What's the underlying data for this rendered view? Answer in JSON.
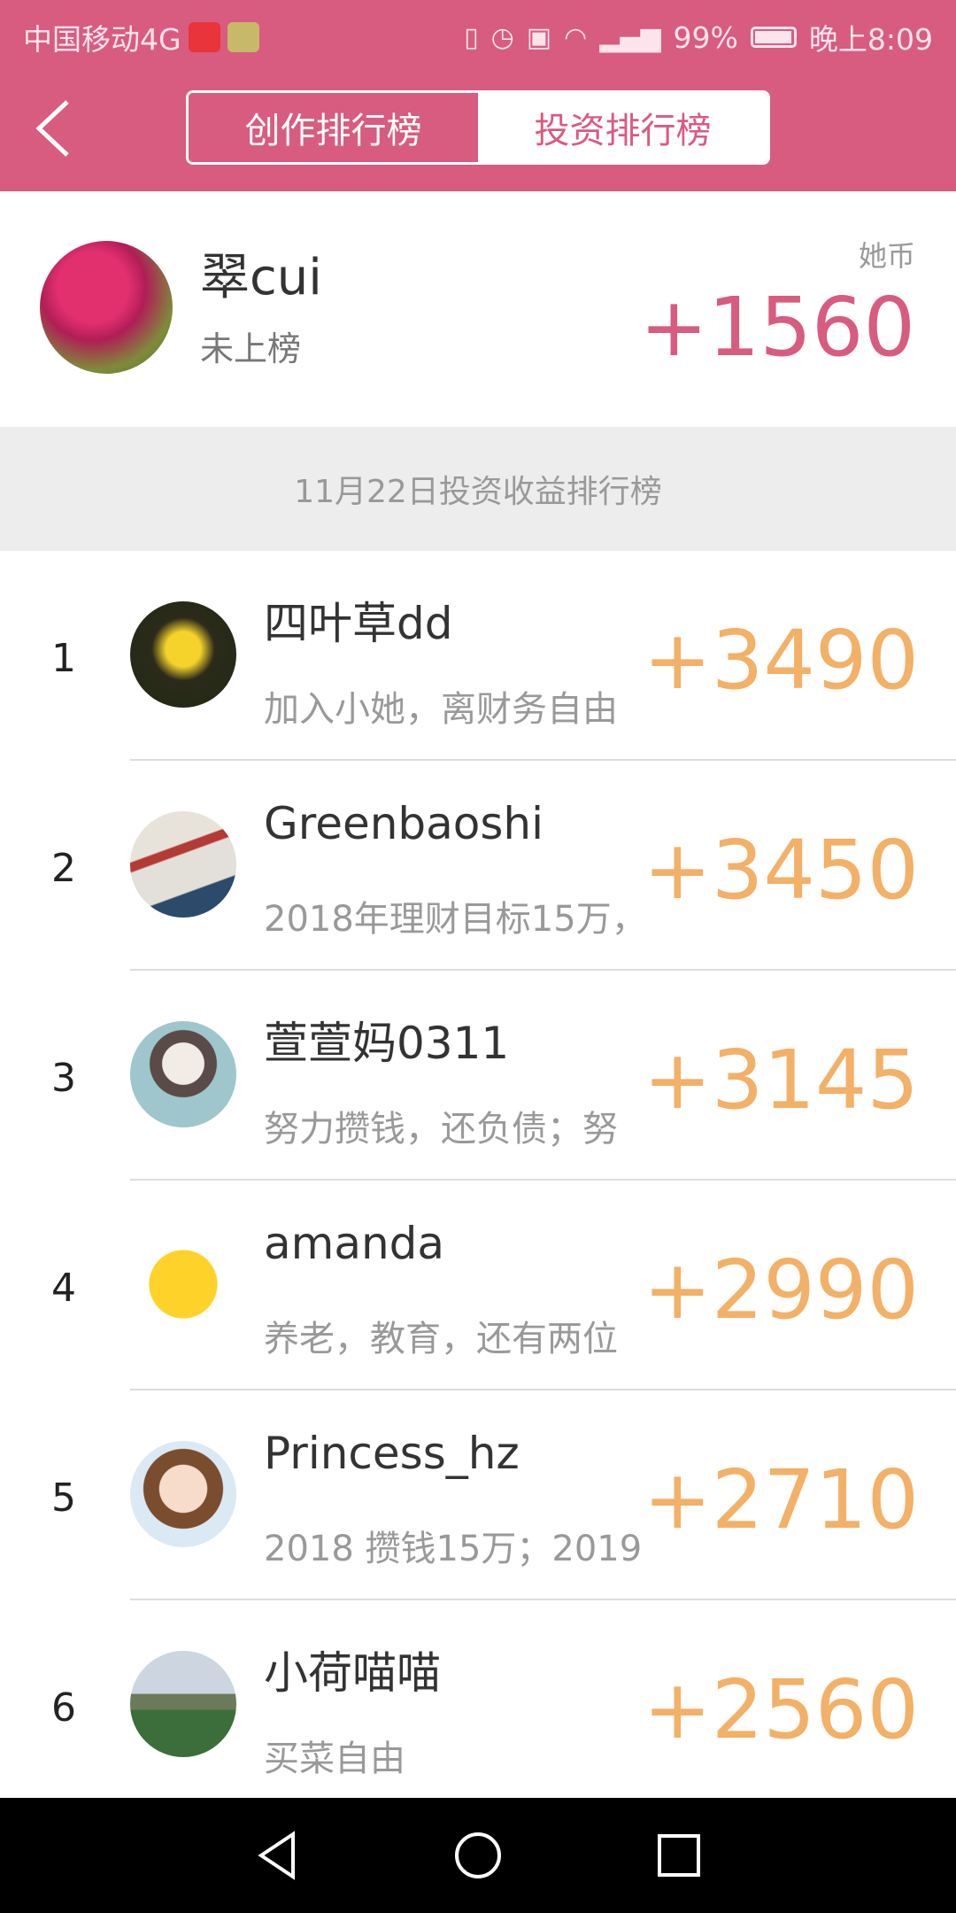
{
  "status_bar": {
    "carrier": "中国移动4G",
    "battery_percent": "99%",
    "time": "晚上8:09"
  },
  "header": {
    "tabs": [
      {
        "label": "创作排行榜",
        "active": true
      },
      {
        "label": "投资排行榜",
        "active": false
      }
    ]
  },
  "me": {
    "name": "翠cui",
    "status": "未上榜",
    "coin_label": "她币",
    "score": "+1560"
  },
  "section_title": "11月22日投资收益排行榜",
  "ranking": [
    {
      "rank": "1",
      "name": "四叶草dd",
      "desc": "加入小她，离财务自由",
      "score": "+3490"
    },
    {
      "rank": "2",
      "name": "Greenbaoshi",
      "desc": "2018年理财目标15万，",
      "score": "+3450"
    },
    {
      "rank": "3",
      "name": "萱萱妈0311",
      "desc": "努力攒钱，还负债；努",
      "score": "+3145"
    },
    {
      "rank": "4",
      "name": "amanda",
      "desc": "养老，教育，还有两位",
      "score": "+2990"
    },
    {
      "rank": "5",
      "name": "Princess_hz",
      "desc": "2018 攒钱15万；2019",
      "score": "+2710"
    },
    {
      "rank": "6",
      "name": "小荷喵喵",
      "desc": "买菜自由",
      "score": "+2560"
    }
  ],
  "colors": {
    "brand": "#d85b80",
    "score_orange": "#f3b067"
  }
}
